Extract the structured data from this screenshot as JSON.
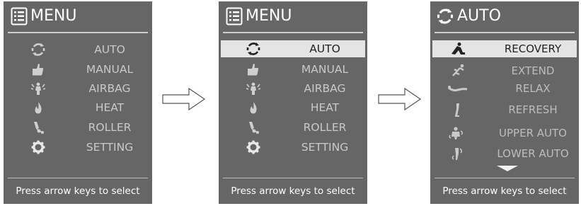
{
  "screens": [
    {
      "title": "MENU",
      "header_icon": "list-icon",
      "items": [
        {
          "label": "AUTO",
          "icon": "cycle-icon"
        },
        {
          "label": "MANUAL",
          "icon": "thumb-icon"
        },
        {
          "label": "AIRBAG",
          "icon": "airbag-icon"
        },
        {
          "label": "HEAT",
          "icon": "flame-icon"
        },
        {
          "label": "ROLLER",
          "icon": "roller-icon"
        },
        {
          "label": "SETTING",
          "icon": "gear-icon"
        }
      ],
      "footer": "Press arrow keys to select"
    },
    {
      "title": "MENU",
      "header_icon": "list-icon",
      "selected": "AUTO",
      "items": [
        {
          "label": "AUTO",
          "icon": "cycle-icon"
        },
        {
          "label": "MANUAL",
          "icon": "thumb-icon"
        },
        {
          "label": "AIRBAG",
          "icon": "airbag-icon"
        },
        {
          "label": "HEAT",
          "icon": "flame-icon"
        },
        {
          "label": "ROLLER",
          "icon": "roller-icon"
        },
        {
          "label": "SETTING",
          "icon": "gear-icon"
        }
      ],
      "footer": "Press arrow keys to select"
    },
    {
      "title": "AUTO",
      "header_icon": "cycle-icon",
      "selected": "RECOVERY",
      "items": [
        {
          "label": "RECOVERY",
          "icon": "recovery-figure-icon"
        },
        {
          "label": "EXTEND",
          "icon": "extend-figure-icon"
        },
        {
          "label": "RELAX",
          "icon": "relax-figure-icon"
        },
        {
          "label": "REFRESH",
          "icon": "refresh-figure-icon"
        },
        {
          "label": "UPPER AUTO",
          "icon": "upper-body-icon"
        },
        {
          "label": "LOWER AUTO",
          "icon": "lower-body-icon"
        }
      ],
      "more_indicator": "chevron-down-icon",
      "footer": "Press arrow keys to select"
    }
  ],
  "flow_arrows": [
    "right-arrow-icon",
    "right-arrow-icon"
  ],
  "colors": {
    "screen_bg": "#666666",
    "text_primary": "#ffffff",
    "text_item": "#c9c9c9",
    "highlight_bg": "#e4e4e4",
    "highlight_text": "#222222"
  }
}
